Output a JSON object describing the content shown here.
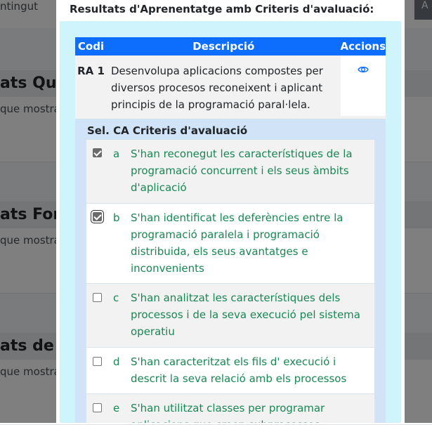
{
  "background": {
    "tab_label": "ntingut",
    "button_label": "A",
    "cards": [
      {
        "title": "ats Qua",
        "subtitle": "que mostra"
      },
      {
        "title": "ats Forr",
        "subtitle": "que mostra"
      },
      {
        "title": "ats de R",
        "subtitle": "que mostra"
      }
    ]
  },
  "modal": {
    "title": "Resultats d'Aprenentatge amb Criteris d'avaluació:",
    "table": {
      "headers": {
        "code": "Codi",
        "description": "Descripció",
        "actions": "Accions"
      },
      "row": {
        "code": "RA 1",
        "description": "Desenvolupa aplicacions compostes per diversos procesos reconeixent i aplicant principis de la programació paral·lela.",
        "action_icon": "eye-icon"
      }
    },
    "criteria": {
      "header_sel": "Sel.",
      "header_ca": "CA",
      "header_label": "Criteris d'avaluació",
      "items": [
        {
          "letter": "a",
          "text": "S'han reconegut les característiques de la programació concurrent i els seus àmbits d'aplicació",
          "checked": true
        },
        {
          "letter": "b",
          "text": "S'han identificat les deferències entre la programació paralela i programació distribuida, els seus avantatges e inconvenients",
          "checked": true
        },
        {
          "letter": "c",
          "text": "S'han analitzat les característiques dels processos i de la seva execució pel sistema operatiu",
          "checked": false
        },
        {
          "letter": "d",
          "text": "S'han caracteritzat els fils d' execució i descrit la seva relació amb els processos",
          "checked": false
        },
        {
          "letter": "e",
          "text": "S'han utilitzat classes per programar aplicacions que creen subprocessos",
          "checked": false
        }
      ]
    }
  },
  "colors": {
    "header_blue": "#0d6efd",
    "body_cyan": "#cff4fc",
    "criteria_text_green": "#198754",
    "criteria_panel": "#d0e3f7"
  }
}
